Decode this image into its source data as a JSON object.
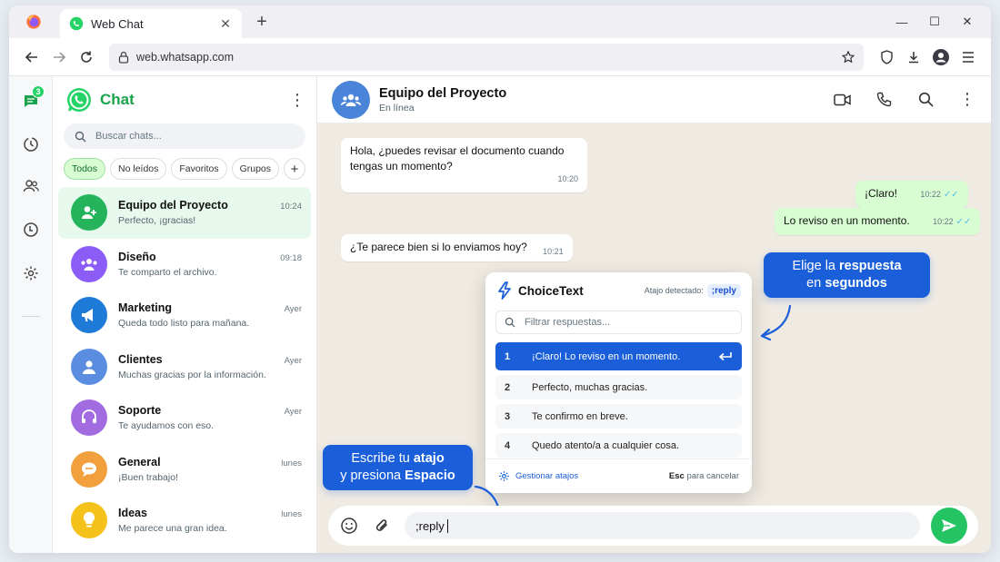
{
  "browser": {
    "tab_title": "Web Chat",
    "url": "web.whatsapp.com"
  },
  "rail": {
    "badge": "3"
  },
  "chatlist": {
    "title": "Chat",
    "search_placeholder": "Buscar chats...",
    "filters": [
      "Todos",
      "No leídos",
      "Favoritos",
      "Grupos"
    ],
    "chats": [
      {
        "name": "Equipo del Proyecto",
        "time": "10:24",
        "last": "Perfecto, ¡gracias!",
        "color": "#25b45c",
        "icon": "group-person-icon"
      },
      {
        "name": "Diseño",
        "time": "09:18",
        "last": "Te comparto el archivo.",
        "color": "#8b5cf6",
        "icon": "group-icon"
      },
      {
        "name": "Marketing",
        "time": "Ayer",
        "last": "Queda todo listo para mañana.",
        "color": "#1e7bd8",
        "icon": "megaphone-icon"
      },
      {
        "name": "Clientes",
        "time": "Ayer",
        "last": "Muchas gracias por la información.",
        "color": "#5a8de0",
        "icon": "person-icon"
      },
      {
        "name": "Soporte",
        "time": "Ayer",
        "last": "Te ayudamos con eso.",
        "color": "#a36be0",
        "icon": "headset-icon"
      },
      {
        "name": "General",
        "time": "lunes",
        "last": "¡Buen trabajo!",
        "color": "#f2a03d",
        "icon": "chat-bubble-icon"
      },
      {
        "name": "Ideas",
        "time": "lunes",
        "last": "Me parece una gran idea.",
        "color": "#f5c21b",
        "icon": "lightbulb-icon"
      }
    ]
  },
  "conversation": {
    "name": "Equipo del Proyecto",
    "status": "En línea",
    "messages": [
      {
        "text": "Hola, ¿puedes revisar el documento cuando tengas un momento?",
        "time": "10:20",
        "direction": "in"
      },
      {
        "text": "¡Claro!",
        "time": "10:22",
        "direction": "out"
      },
      {
        "text": "Lo reviso en un momento.",
        "time": "10:22",
        "direction": "out"
      },
      {
        "text": "¿Te parece bien si lo enviamos hoy?",
        "time": "10:21",
        "direction": "in"
      }
    ],
    "composer_text": ";reply"
  },
  "choicetext": {
    "brand": "ChoiceText",
    "detected_label": "Atajo detectado:",
    "detected_code": ";reply",
    "filter_placeholder": "Filtrar respuestas...",
    "options": [
      {
        "num": "1",
        "label": "¡Claro! Lo reviso en un momento."
      },
      {
        "num": "2",
        "label": "Perfecto, muchas gracias."
      },
      {
        "num": "3",
        "label": "Te confirmo en breve."
      },
      {
        "num": "4",
        "label": "Quedo atento/a a cualquier cosa."
      }
    ],
    "manage_label": "Gestionar atajos",
    "esc_key": "Esc",
    "esc_label": "para cancelar"
  },
  "callouts": {
    "top_line1": "Elige la",
    "top_bold1": "respuesta",
    "top_line2": "en",
    "top_bold2": "segundos",
    "bottom_line1": "Escribe tu",
    "bottom_bold1": "atajo",
    "bottom_line2": "y presiona",
    "bottom_bold2": "Espacio"
  },
  "colors": {
    "accent_green": "#25d366",
    "popup_blue": "#1a5fd9",
    "out_bubble": "#d9fdd3",
    "chat_bg": "#efeae2"
  }
}
